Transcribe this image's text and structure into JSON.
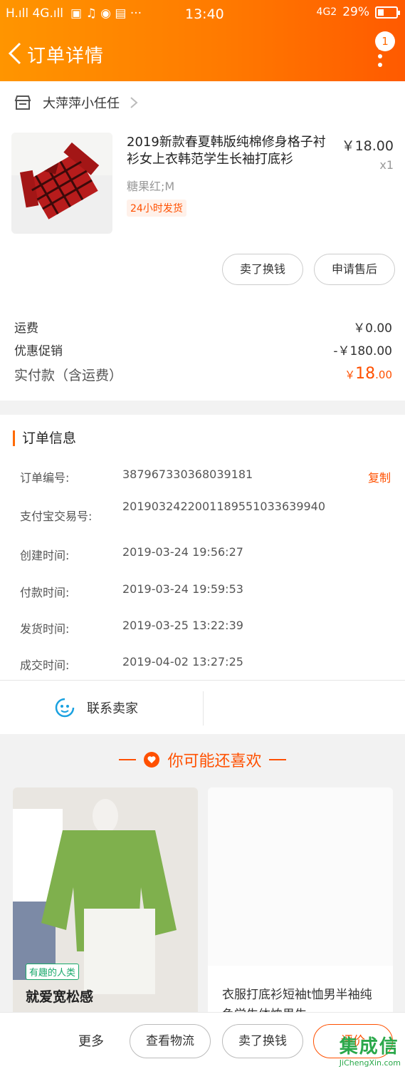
{
  "status_bar": {
    "signal": "H.ıll 4G.ıll",
    "time": "13:40",
    "network": "4G2",
    "battery": "29%"
  },
  "header": {
    "title": "订单详情",
    "badge": "1"
  },
  "shop": {
    "name": "大萍萍小任任"
  },
  "product": {
    "title": "2019新款春夏韩版纯棉修身格子衬衫女上衣韩范学生长袖打底衫",
    "price": "￥18.00",
    "quantity": "x1",
    "sku": "糖果红;M",
    "tag": "24小时发货"
  },
  "actions": {
    "resell": "卖了换钱",
    "after_sale": "申请售后"
  },
  "fees": {
    "shipping_label": "运费",
    "shipping_value": "￥0.00",
    "discount_label": "优惠促销",
    "discount_value": "-￥180.00",
    "total_label": "实付款（含运费）",
    "total_currency": "￥",
    "total_int": "18",
    "total_dec": ".00"
  },
  "order_info": {
    "heading": "订单信息",
    "copy": "复制",
    "rows": [
      {
        "label": "订单编号:",
        "value": "387967330368039181"
      },
      {
        "label": "支付宝交易号:",
        "value": "2019032422001189551033639940"
      },
      {
        "label": "创建时间:",
        "value": "2019-03-24 19:56:27"
      },
      {
        "label": "付款时间:",
        "value": "2019-03-24 19:59:53"
      },
      {
        "label": "发货时间:",
        "value": "2019-03-25 13:22:39"
      },
      {
        "label": "成交时间:",
        "value": "2019-04-02 13:27:25"
      }
    ],
    "contact": "联系卖家"
  },
  "recommend": {
    "title": "你可能还喜欢",
    "items": [
      {
        "tag": "有趣的人类",
        "name": "就爱宽松感"
      },
      {
        "name": "衣服打底衫短袖t恤男半袖纯色学生体恤男生"
      }
    ]
  },
  "bottom_bar": {
    "more": "更多",
    "logistics": "查看物流",
    "resell": "卖了换钱",
    "review": "评价"
  },
  "watermark": {
    "main": "集成信",
    "sub": "JiChengXin.com"
  },
  "colors": {
    "accent": "#ff5000",
    "header_start": "#ff9500",
    "header_end": "#ff5a00"
  }
}
